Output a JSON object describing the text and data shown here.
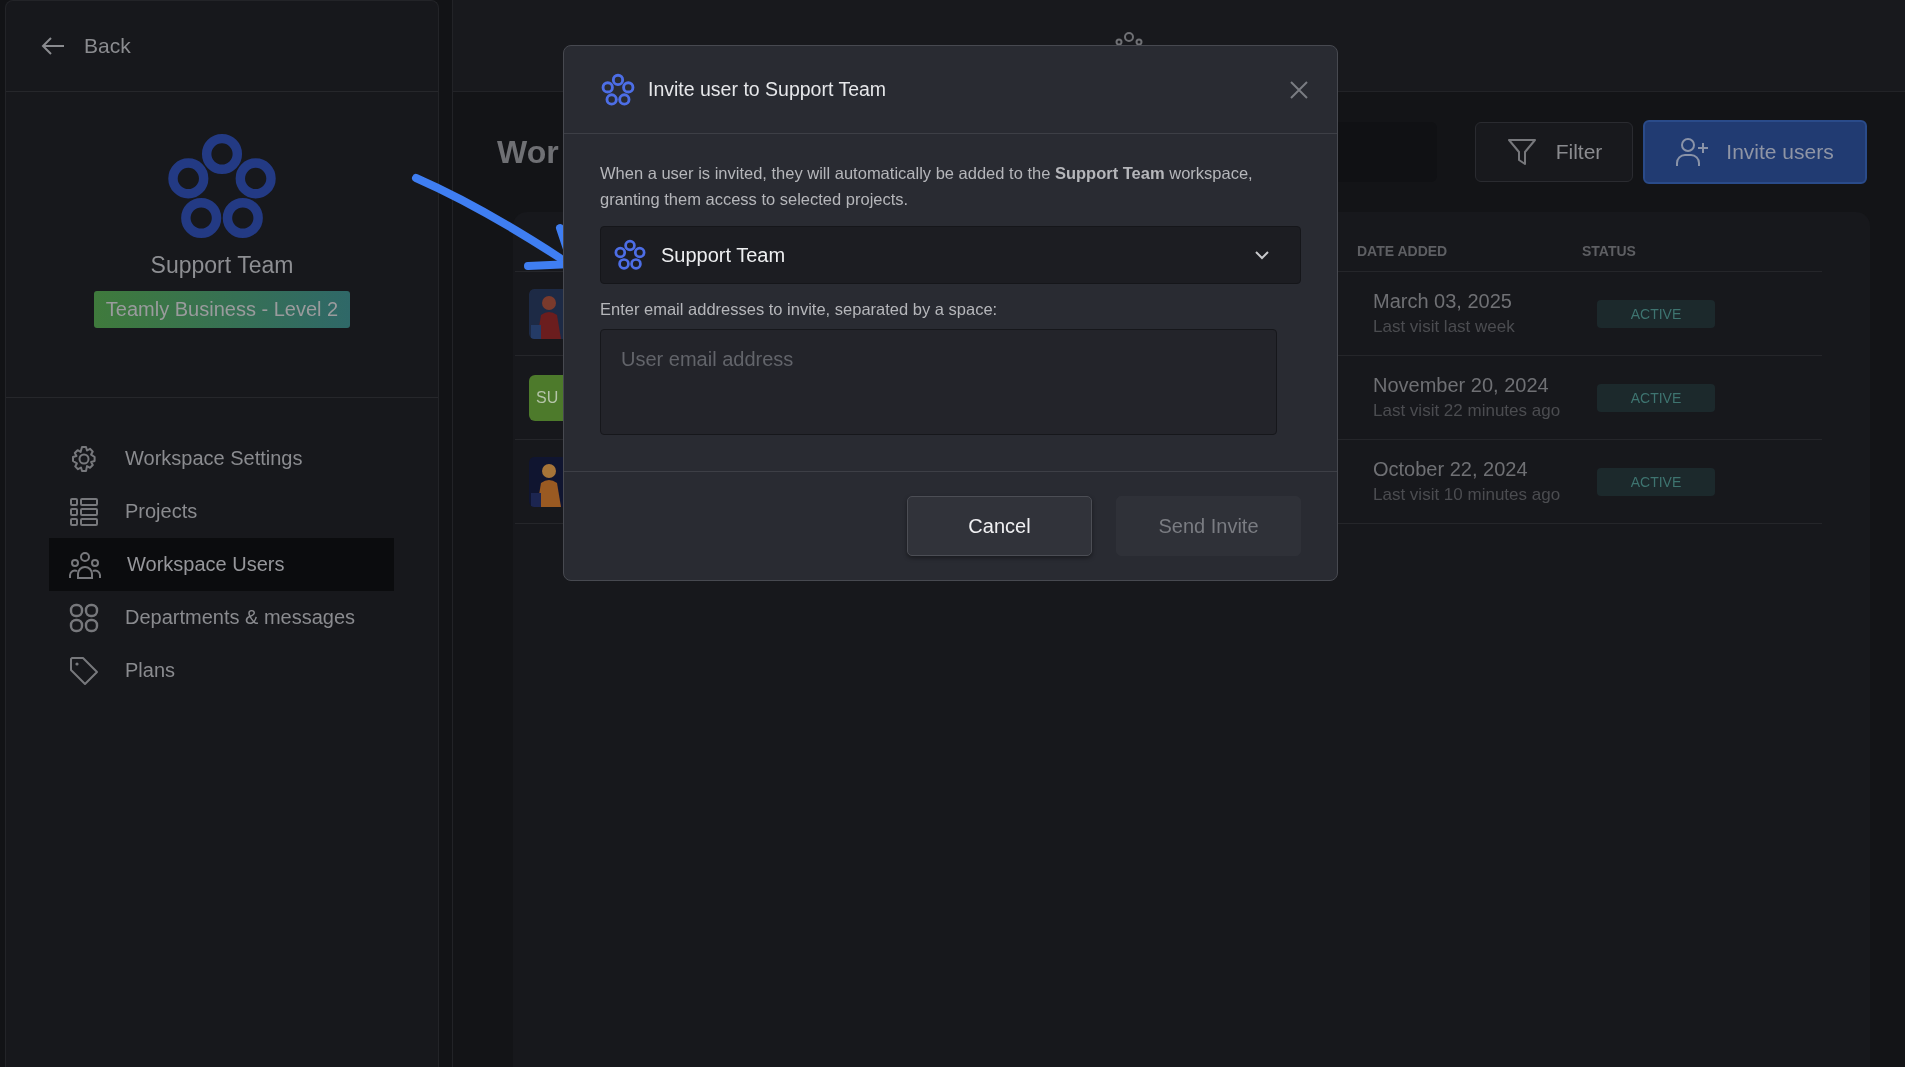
{
  "sidebar": {
    "back": "Back",
    "workspace_name": "Support Team",
    "plan_badge": "Teamly Business - Level 2",
    "items": [
      {
        "label": "Workspace Settings",
        "selected": false
      },
      {
        "label": "Projects",
        "selected": false
      },
      {
        "label": "Workspace Users",
        "selected": true
      },
      {
        "label": "Departments & messages",
        "selected": false
      },
      {
        "label": "Plans",
        "selected": false
      }
    ]
  },
  "main": {
    "page_title": "Wor",
    "filter_button": "Filter",
    "invite_button": "Invite users",
    "table": {
      "columns": [
        "DATE ADDED",
        "STATUS"
      ],
      "rows": [
        {
          "date": "March 03, 2025",
          "last_visit": "Last visit last week",
          "status": "ACTIVE"
        },
        {
          "avatar": {
            "kind": "initials",
            "text": "SU"
          },
          "date": "November 20, 2024",
          "last_visit": "Last visit 22 minutes ago",
          "status": "ACTIVE"
        },
        {
          "date": "October 22, 2024",
          "last_visit": "Last visit 10 minutes ago",
          "status": "ACTIVE"
        }
      ]
    }
  },
  "modal": {
    "title": "Invite user to Support Team",
    "description": "When a user is invited, they will automatically be added to the **Support Team** workspace, granting them access to selected projects.",
    "workspace_select": {
      "value": "Support Team"
    },
    "email_label": "Enter email addresses to invite, separated by a space:",
    "email_field": {
      "placeholder": "User email address"
    },
    "buttons": [
      {
        "label": "Cancel",
        "disabled": false
      },
      {
        "label": "Send Invite",
        "disabled": true
      }
    ]
  }
}
